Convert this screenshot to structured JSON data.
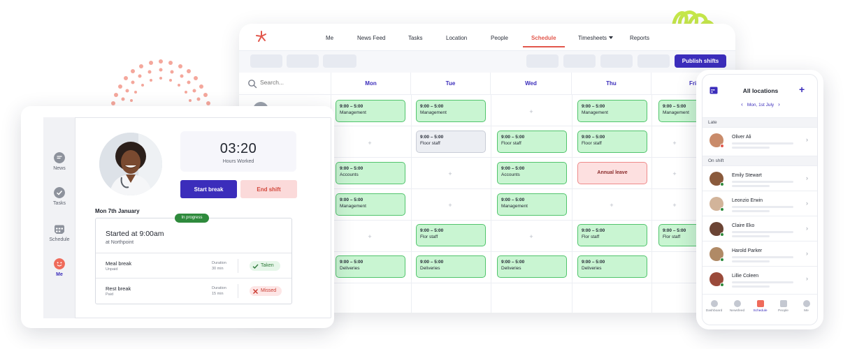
{
  "scheduler": {
    "nav": {
      "me": "Me",
      "news_feed": "News Feed",
      "tasks": "Tasks",
      "location": "Location",
      "people": "People",
      "schedule": "Schedule",
      "timesheets": "Timesheets",
      "reports": "Reports"
    },
    "publish_label": "Publish shifts",
    "search_placeholder": "Search...",
    "days": [
      "Mon",
      "Tue",
      "Wed",
      "Thu",
      "Fri"
    ],
    "shifts": {
      "mon_management_1": {
        "time": "9:00 – 5:00",
        "role": "Management"
      },
      "mon_accounts": {
        "time": "9:00 – 5:00",
        "role": "Accounts"
      },
      "mon_management_2": {
        "time": "9:00 – 5:00",
        "role": "Management"
      },
      "mon_deliveries": {
        "time": "9:00 – 5:00",
        "role": "Deliveries"
      },
      "tue_management": {
        "time": "9:00 – 5:00",
        "role": "Management"
      },
      "tue_floor": {
        "time": "9:00 – 5:00",
        "role": "Floor staff"
      },
      "tue_flor": {
        "time": "9:00 – 5:00",
        "role": "Flor staff"
      },
      "tue_deliveries": {
        "time": "9:00 – 5:00",
        "role": "Deliveries"
      },
      "wed_floor": {
        "time": "9:00 – 5:00",
        "role": "Floor staff"
      },
      "wed_accounts": {
        "time": "9:00 – 5:00",
        "role": "Accounts"
      },
      "wed_management": {
        "time": "9:00 – 5:00",
        "role": "Management"
      },
      "wed_deliveries": {
        "time": "9:00 – 5:00",
        "role": "Deliveries"
      },
      "thu_management": {
        "time": "9:00 – 5:00",
        "role": "Management"
      },
      "thu_floor": {
        "time": "9:00 – 5:00",
        "role": "Floor staff"
      },
      "thu_leave": {
        "role": "Annual leave"
      },
      "thu_flor": {
        "time": "9:00 – 5:00",
        "role": "Flor staff"
      },
      "thu_deliveries": {
        "time": "9:00 – 5:00",
        "role": "Deliveries"
      },
      "fri_management": {
        "time": "9:00 – 5:00",
        "role": "Management"
      },
      "fri_flor": {
        "time": "9:00 – 5:00",
        "role": "Flor staff"
      }
    },
    "add_symbol": "+"
  },
  "tablet": {
    "sidebar": {
      "news": "News",
      "tasks": "Tasks",
      "schedule": "Schedule",
      "me": "Me"
    },
    "clock": {
      "time": "03:20",
      "label": "Hours Worked"
    },
    "start_break": "Start break",
    "end_shift": "End shift",
    "date": "Mon 7th January",
    "status_badge": "In progress",
    "shift_title": "Started at 9:00am",
    "shift_location": "at Northpoint",
    "breaks": [
      {
        "name": "Meal break",
        "type": "Unpaid",
        "duration_label": "Duration",
        "duration": "30 min",
        "status": "Taken"
      },
      {
        "name": "Rest break",
        "type": "Paid",
        "duration_label": "Duration",
        "duration": "15 min",
        "status": "Missed"
      }
    ]
  },
  "phone": {
    "title": "All locations",
    "date": "Mon, 1st July",
    "sections": {
      "late": "Late",
      "on_shift": "On shift"
    },
    "people": [
      {
        "name": "Oliver Ali",
        "status_color": "#e2574c"
      },
      {
        "name": "Emily Stewart",
        "status_color": "#2e8a3c"
      },
      {
        "name": "Leonzio Erwin",
        "status_color": "#2e8a3c"
      },
      {
        "name": "Claire Eko",
        "status_color": "#2e8a3c"
      },
      {
        "name": "Harold Parker",
        "status_color": "#2e8a3c"
      },
      {
        "name": "Lillie Coleen",
        "status_color": "#2e8a3c"
      }
    ],
    "tabs": [
      "Dashboard",
      "Newsfeed",
      "Schedule",
      "People",
      "Me"
    ]
  },
  "colors": {
    "brand": "#3b2dbb",
    "accent": "#e2574c",
    "shift_green": "#c9f5d2",
    "leave_pink": "#fde0e0"
  }
}
